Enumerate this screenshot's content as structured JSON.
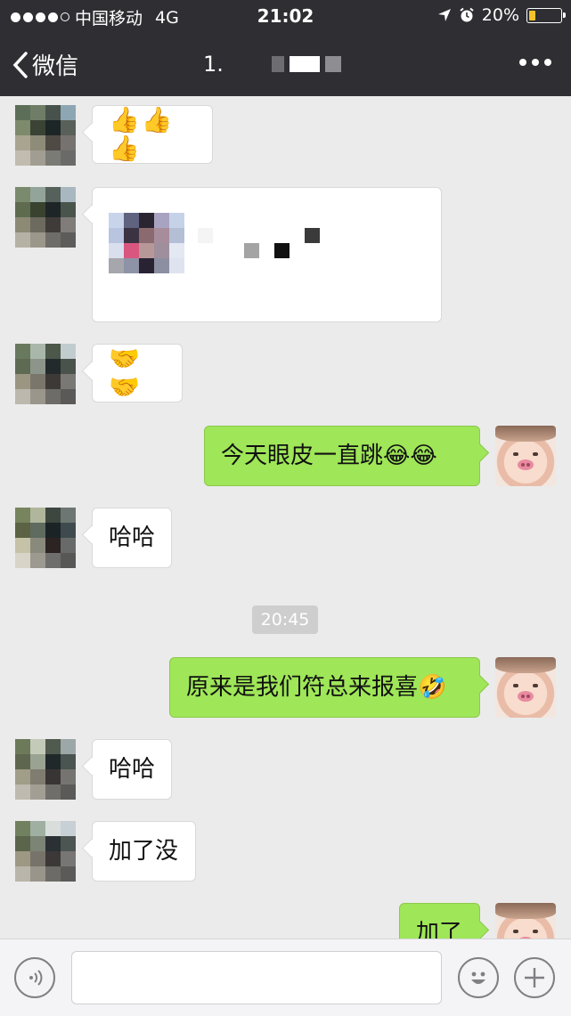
{
  "status_bar": {
    "carrier": "中国移动",
    "network": "4G",
    "time": "21:02",
    "battery_percent": "20%",
    "battery_level": 0.2
  },
  "nav": {
    "back_label": "微信",
    "title": "1."
  },
  "messages": [
    {
      "side": "in",
      "text": "👍👍👍"
    },
    {
      "side": "in",
      "text": ""
    },
    {
      "side": "in",
      "text": "🤝🤝"
    },
    {
      "side": "out",
      "text": "今天眼皮一直跳😂😂"
    },
    {
      "side": "in",
      "text": "哈哈"
    },
    {
      "side": "out",
      "text": "原来是我们符总来报喜🤣"
    },
    {
      "side": "in",
      "text": "哈哈"
    },
    {
      "side": "in",
      "text": "加了没"
    },
    {
      "side": "out",
      "text": "加了"
    }
  ],
  "timestamp": "20:45",
  "input": {
    "value": "",
    "placeholder": ""
  },
  "colors": {
    "nav_bg": "#2e2e33",
    "chat_bg": "#ebebeb",
    "out_bubble": "#9fe658",
    "in_bubble": "#ffffff",
    "battery_fill": "#f3c32a"
  },
  "icons": [
    "signal-dots-icon",
    "location-arrow-icon",
    "alarm-icon",
    "battery-icon",
    "back-chevron-icon",
    "more-dots-icon",
    "voice-icon",
    "emoji-icon",
    "plus-icon"
  ]
}
